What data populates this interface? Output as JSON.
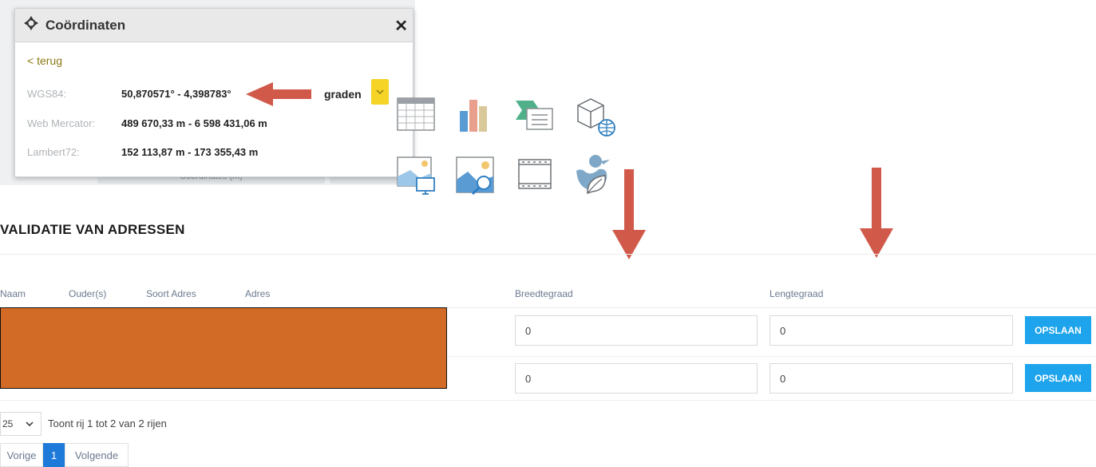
{
  "popup": {
    "title": "Coördinaten",
    "close": "✕",
    "back_link": "< terug",
    "rows": [
      {
        "label": "WGS84:",
        "value": "50,870571° - 4,398783°"
      },
      {
        "label": "Web Mercator:",
        "value": "489 670,33 m - 6 598 431,06 m"
      },
      {
        "label": "Lambert72:",
        "value": "152 113,87 m - 173 355,43 m"
      }
    ],
    "unit": "graden",
    "background_tab_text": "Coördinates (m)"
  },
  "toolbar": {
    "icons": [
      "table-icon",
      "bar-chart-icon",
      "layer-list-icon",
      "3d-globe-icon",
      "map-screen-icon",
      "image-search-icon",
      "film-icon",
      "duck-leaf-icon"
    ]
  },
  "section": {
    "title": "VALIDATIE VAN ADRESSEN"
  },
  "table": {
    "headers": [
      "Naam",
      "Ouder(s)",
      "Soort Adres",
      "Adres",
      "Breedtegraad",
      "Lengtegraad"
    ],
    "rows": [
      {
        "breedtegraad": "0",
        "lengtegraad": "0",
        "save_label": "OPSLAAN"
      },
      {
        "breedtegraad": "0",
        "lengtegraad": "0",
        "save_label": "OPSLAAN"
      }
    ]
  },
  "footer": {
    "page_size": "25",
    "rows_info": "Toont rij 1 tot 2 van 2 rijen",
    "prev": "Vorige",
    "page": "1",
    "next": "Volgende"
  },
  "colors": {
    "arrow": "#d0594a",
    "accent_yellow": "#f5d327",
    "save_button": "#1ea4ec",
    "redacted": "#d16b26",
    "active_page": "#1e7ad8"
  }
}
